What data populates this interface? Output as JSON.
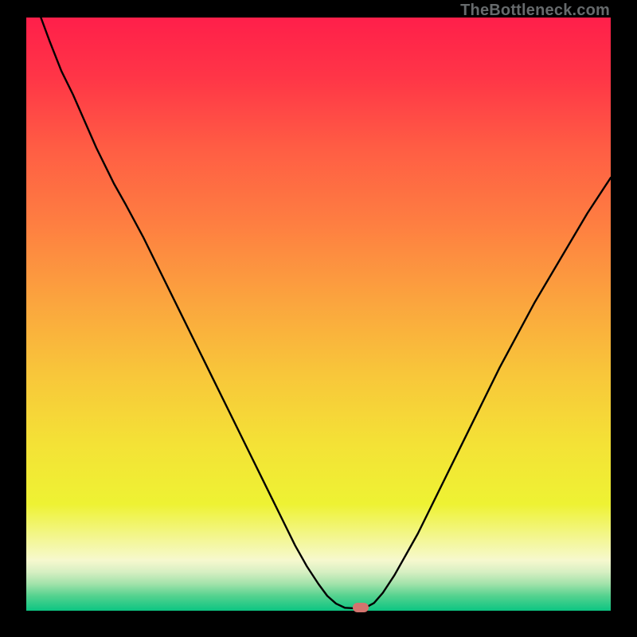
{
  "watermark": "TheBottleneck.com",
  "marker_color": "#d4746e",
  "chart_data": {
    "type": "line",
    "title": "",
    "xlabel": "",
    "ylabel": "",
    "xlim": [
      0,
      100
    ],
    "ylim": [
      0,
      100
    ],
    "curve": [
      {
        "x": 2.5,
        "y": 100
      },
      {
        "x": 4,
        "y": 96
      },
      {
        "x": 6,
        "y": 91
      },
      {
        "x": 8,
        "y": 87
      },
      {
        "x": 10,
        "y": 82.5
      },
      {
        "x": 12,
        "y": 78
      },
      {
        "x": 14,
        "y": 74
      },
      {
        "x": 15,
        "y": 72
      },
      {
        "x": 17,
        "y": 68.5
      },
      {
        "x": 20,
        "y": 63
      },
      {
        "x": 23,
        "y": 57
      },
      {
        "x": 26,
        "y": 51
      },
      {
        "x": 29,
        "y": 45
      },
      {
        "x": 32,
        "y": 39
      },
      {
        "x": 35,
        "y": 33
      },
      {
        "x": 38,
        "y": 27
      },
      {
        "x": 41,
        "y": 21
      },
      {
        "x": 44,
        "y": 15
      },
      {
        "x": 46,
        "y": 11
      },
      {
        "x": 48,
        "y": 7.5
      },
      {
        "x": 50,
        "y": 4.5
      },
      {
        "x": 51.5,
        "y": 2.5
      },
      {
        "x": 53,
        "y": 1.2
      },
      {
        "x": 54.5,
        "y": 0.5
      },
      {
        "x": 56.5,
        "y": 0.4
      },
      {
        "x": 58,
        "y": 0.5
      },
      {
        "x": 59.5,
        "y": 1.3
      },
      {
        "x": 61,
        "y": 3
      },
      {
        "x": 63,
        "y": 6
      },
      {
        "x": 65,
        "y": 9.5
      },
      {
        "x": 67,
        "y": 13
      },
      {
        "x": 69,
        "y": 17
      },
      {
        "x": 72,
        "y": 23
      },
      {
        "x": 75,
        "y": 29
      },
      {
        "x": 78,
        "y": 35
      },
      {
        "x": 81,
        "y": 41
      },
      {
        "x": 84,
        "y": 46.5
      },
      {
        "x": 87,
        "y": 52
      },
      {
        "x": 90,
        "y": 57
      },
      {
        "x": 93,
        "y": 62
      },
      {
        "x": 96,
        "y": 67
      },
      {
        "x": 100,
        "y": 73
      }
    ],
    "marker": {
      "x": 57.2,
      "y": 0.5
    },
    "gradient_stops": [
      {
        "offset": 0,
        "color": "#ff1f4a"
      },
      {
        "offset": 0.1,
        "color": "#ff3547"
      },
      {
        "offset": 0.22,
        "color": "#ff5d44"
      },
      {
        "offset": 0.35,
        "color": "#fe7f41"
      },
      {
        "offset": 0.48,
        "color": "#fba53e"
      },
      {
        "offset": 0.6,
        "color": "#f8c63a"
      },
      {
        "offset": 0.72,
        "color": "#f4e236"
      },
      {
        "offset": 0.82,
        "color": "#eef233"
      },
      {
        "offset": 0.885,
        "color": "#f4f79e"
      },
      {
        "offset": 0.915,
        "color": "#f6f8ce"
      },
      {
        "offset": 0.935,
        "color": "#d6efc2"
      },
      {
        "offset": 0.955,
        "color": "#a1e2aa"
      },
      {
        "offset": 0.975,
        "color": "#55d28f"
      },
      {
        "offset": 1.0,
        "color": "#0cc582"
      }
    ]
  }
}
